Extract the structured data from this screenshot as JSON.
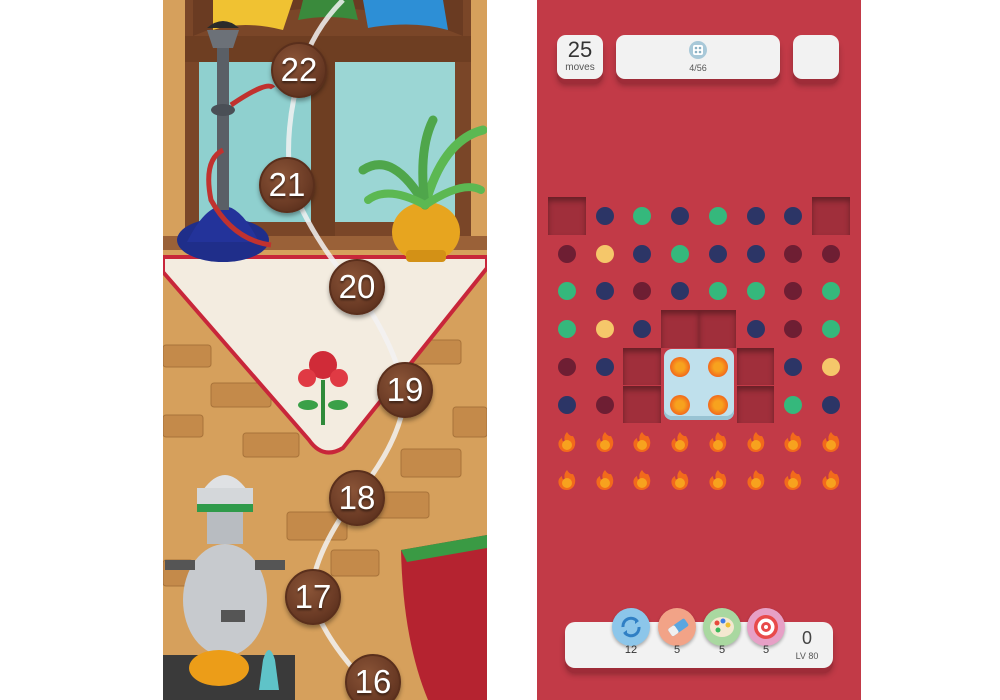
{
  "map": {
    "levels": [
      "16",
      "17",
      "18",
      "19",
      "20",
      "21",
      "22"
    ]
  },
  "hud": {
    "moves_count": "25",
    "moves_label": "moves",
    "goal_progress": "4/56"
  },
  "board": {
    "rows": [
      [
        "hole",
        "navy",
        "green",
        "navy",
        "green",
        "navy",
        "navy",
        "hole"
      ],
      [
        "maroon",
        "yellow",
        "navy",
        "green",
        "navy",
        "navy",
        "maroon",
        "maroon"
      ],
      [
        "green",
        "navy",
        "maroon",
        "navy",
        "green",
        "green",
        "maroon",
        "green"
      ],
      [
        "green",
        "yellow",
        "navy",
        "hole",
        "hole",
        "navy",
        "maroon",
        "green"
      ],
      [
        "maroon",
        "navy",
        "hole",
        "die",
        "die",
        "hole",
        "navy",
        "yellow"
      ],
      [
        "navy",
        "maroon",
        "hole",
        "die",
        "die",
        "hole",
        "green",
        "navy"
      ],
      [
        "fire",
        "fire",
        "fire",
        "fire",
        "fire",
        "fire",
        "fire",
        "fire"
      ],
      [
        "fire",
        "fire",
        "fire",
        "fire",
        "fire",
        "fire",
        "fire",
        "fire"
      ]
    ],
    "colors": {
      "navy": "#2c3566",
      "green": "#35b87c",
      "maroon": "#6e1e33",
      "yellow": "#f5c76a",
      "background": "#c23a47"
    }
  },
  "boosters": [
    {
      "icon": "shuffle-icon",
      "count": "12"
    },
    {
      "icon": "eraser-icon",
      "count": "5"
    },
    {
      "icon": "palette-icon",
      "count": "5"
    },
    {
      "icon": "target-icon",
      "count": "5"
    }
  ],
  "score": {
    "value": "0",
    "level_label": "LV 80"
  }
}
